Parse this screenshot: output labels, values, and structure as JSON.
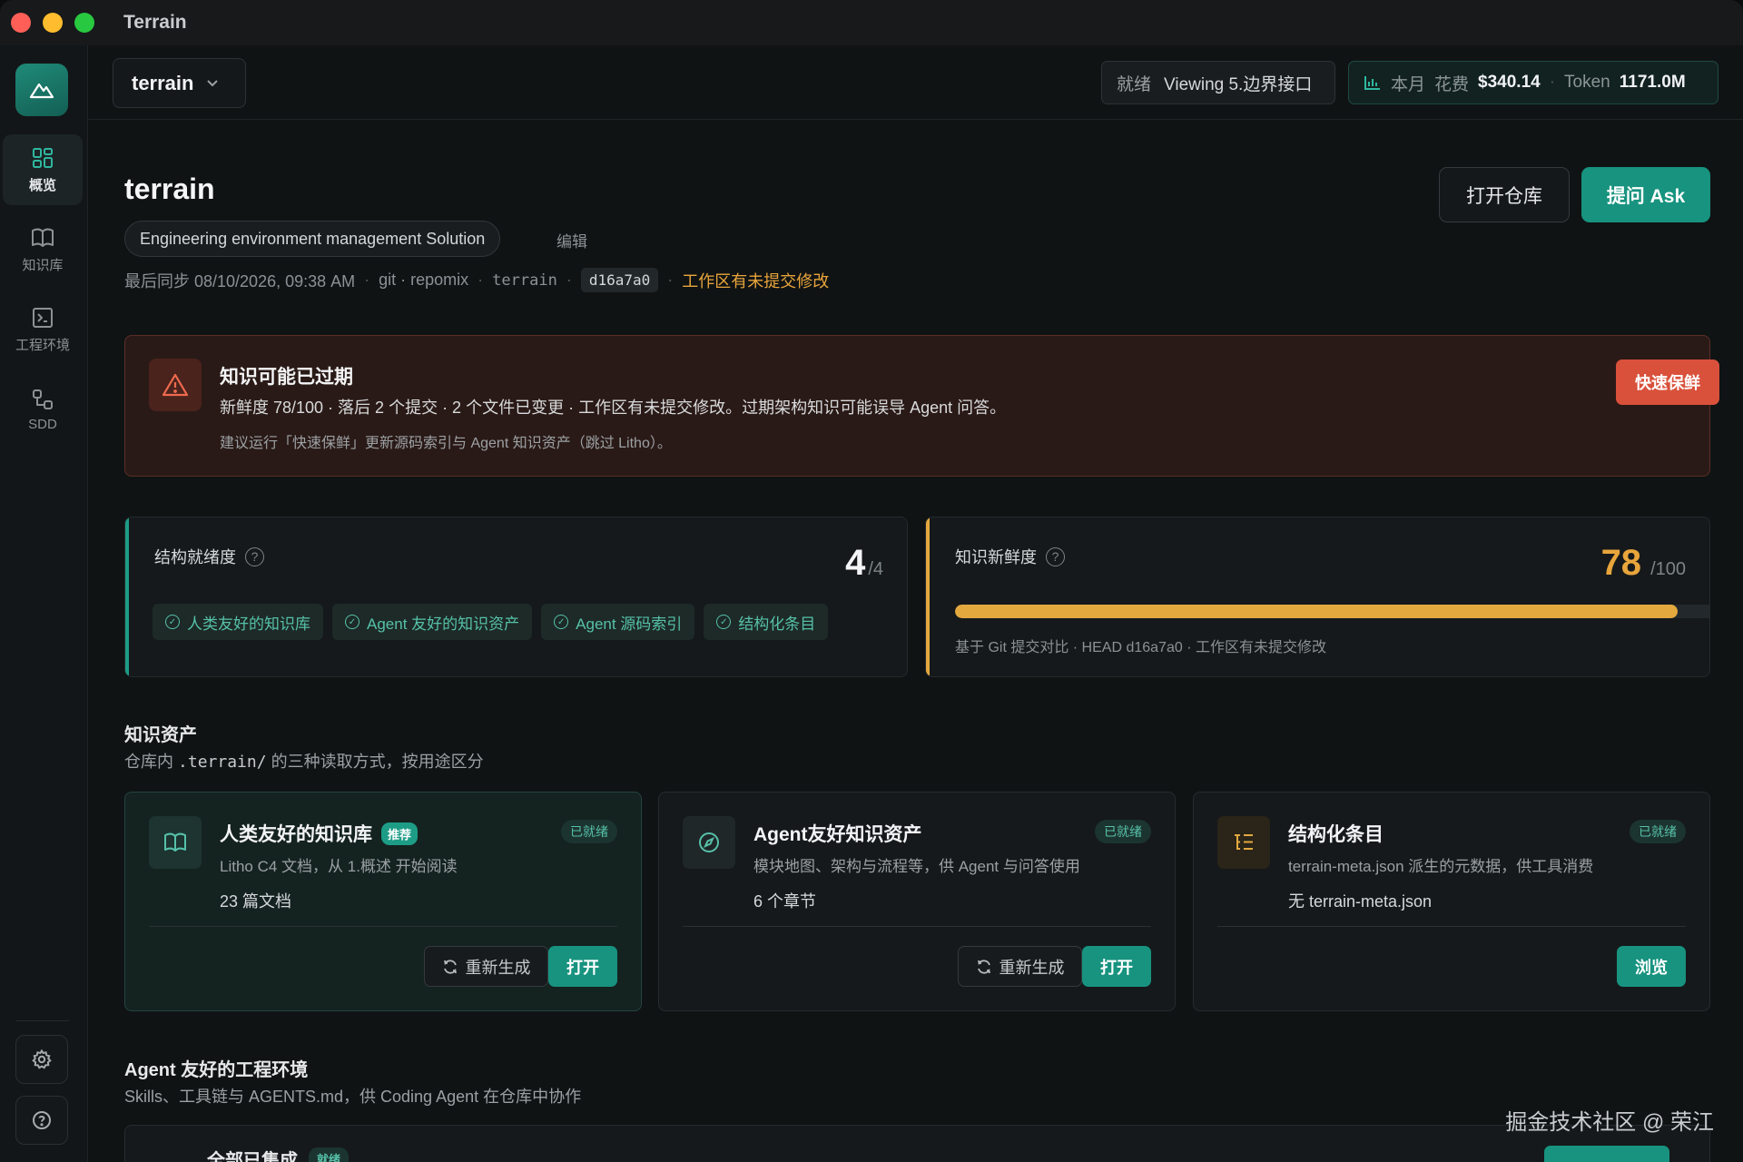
{
  "window": {
    "title": "Terrain"
  },
  "sidebar": {
    "items": [
      {
        "label": "概览",
        "icon": "grid-icon",
        "active": true
      },
      {
        "label": "知识库",
        "icon": "book-icon",
        "active": false
      },
      {
        "label": "工程环境",
        "icon": "terminal-icon",
        "active": false
      },
      {
        "label": "SDD",
        "icon": "flow-icon",
        "active": false
      }
    ]
  },
  "topbar": {
    "project": "terrain",
    "status": {
      "state": "就绪",
      "viewing": "Viewing 5.边界接口"
    },
    "cost": {
      "period": "本月",
      "spend_label": "花费",
      "spend": "$340.14",
      "token_label": "Token",
      "token": "1171.0M"
    }
  },
  "header": {
    "title": "terrain",
    "description": "Engineering environment management Solution",
    "edit": "编辑",
    "open_repo": "打开仓库",
    "ask": "提问 Ask",
    "meta": {
      "last_sync": "最后同步 08/10/2026, 09:38 AM",
      "source": "git · repomix",
      "branch": "terrain",
      "hash": "d16a7a0",
      "dirty": "工作区有未提交修改"
    }
  },
  "alert": {
    "title": "知识可能已过期",
    "body": "新鲜度 78/100 · 落后 2 个提交 · 2 个文件已变更 · 工作区有未提交修改。过期架构知识可能误导 Agent 问答。",
    "hint": "建议运行「快速保鲜」更新源码索引与 Agent 知识资产（跳过 Litho）。",
    "action": "快速保鲜"
  },
  "readiness": {
    "label": "结构就绪度",
    "value": "4",
    "total": "/4",
    "chips": [
      "人类友好的知识库",
      "Agent 友好的知识资产",
      "Agent 源码索引",
      "结构化条目"
    ]
  },
  "freshness": {
    "label": "知识新鲜度",
    "value": "78",
    "total": "/100",
    "level": 0.78,
    "note": "基于 Git 提交对比 · HEAD d16a7a0 · 工作区有未提交修改"
  },
  "assets": {
    "title": "知识资产",
    "sub_prefix": "仓库内",
    "sub_path": ".terrain/",
    "sub_suffix": "的三种读取方式，按用途区分",
    "cards": [
      {
        "title": "人类友好的知识库",
        "badge": "推荐",
        "status": "已就绪",
        "desc": "Litho C4 文档，从 1.概述 开始阅读",
        "count": "23 篇文档",
        "regen": "重新生成",
        "action": "打开"
      },
      {
        "title": "Agent友好知识资产",
        "status": "已就绪",
        "desc": "模块地图、架构与流程等，供 Agent 与问答使用",
        "count": "6 个章节",
        "regen": "重新生成",
        "action": "打开"
      },
      {
        "title": "结构化条目",
        "status": "已就绪",
        "desc": "terrain-meta.json 派生的元数据，供工具消费",
        "count": "无 terrain-meta.json",
        "action": "浏览"
      }
    ]
  },
  "env": {
    "title": "Agent 友好的工程环境",
    "sub": "Skills、工具链与 AGENTS.md，供 Coding Agent 在仓库中协作",
    "card_title": "全部已集成",
    "card_badge": "就绪"
  },
  "watermark": "掘金技术社区 @ 荣江",
  "colors": {
    "accent": "#17937f",
    "warning": "#e8a53b",
    "danger": "#d9513b"
  }
}
